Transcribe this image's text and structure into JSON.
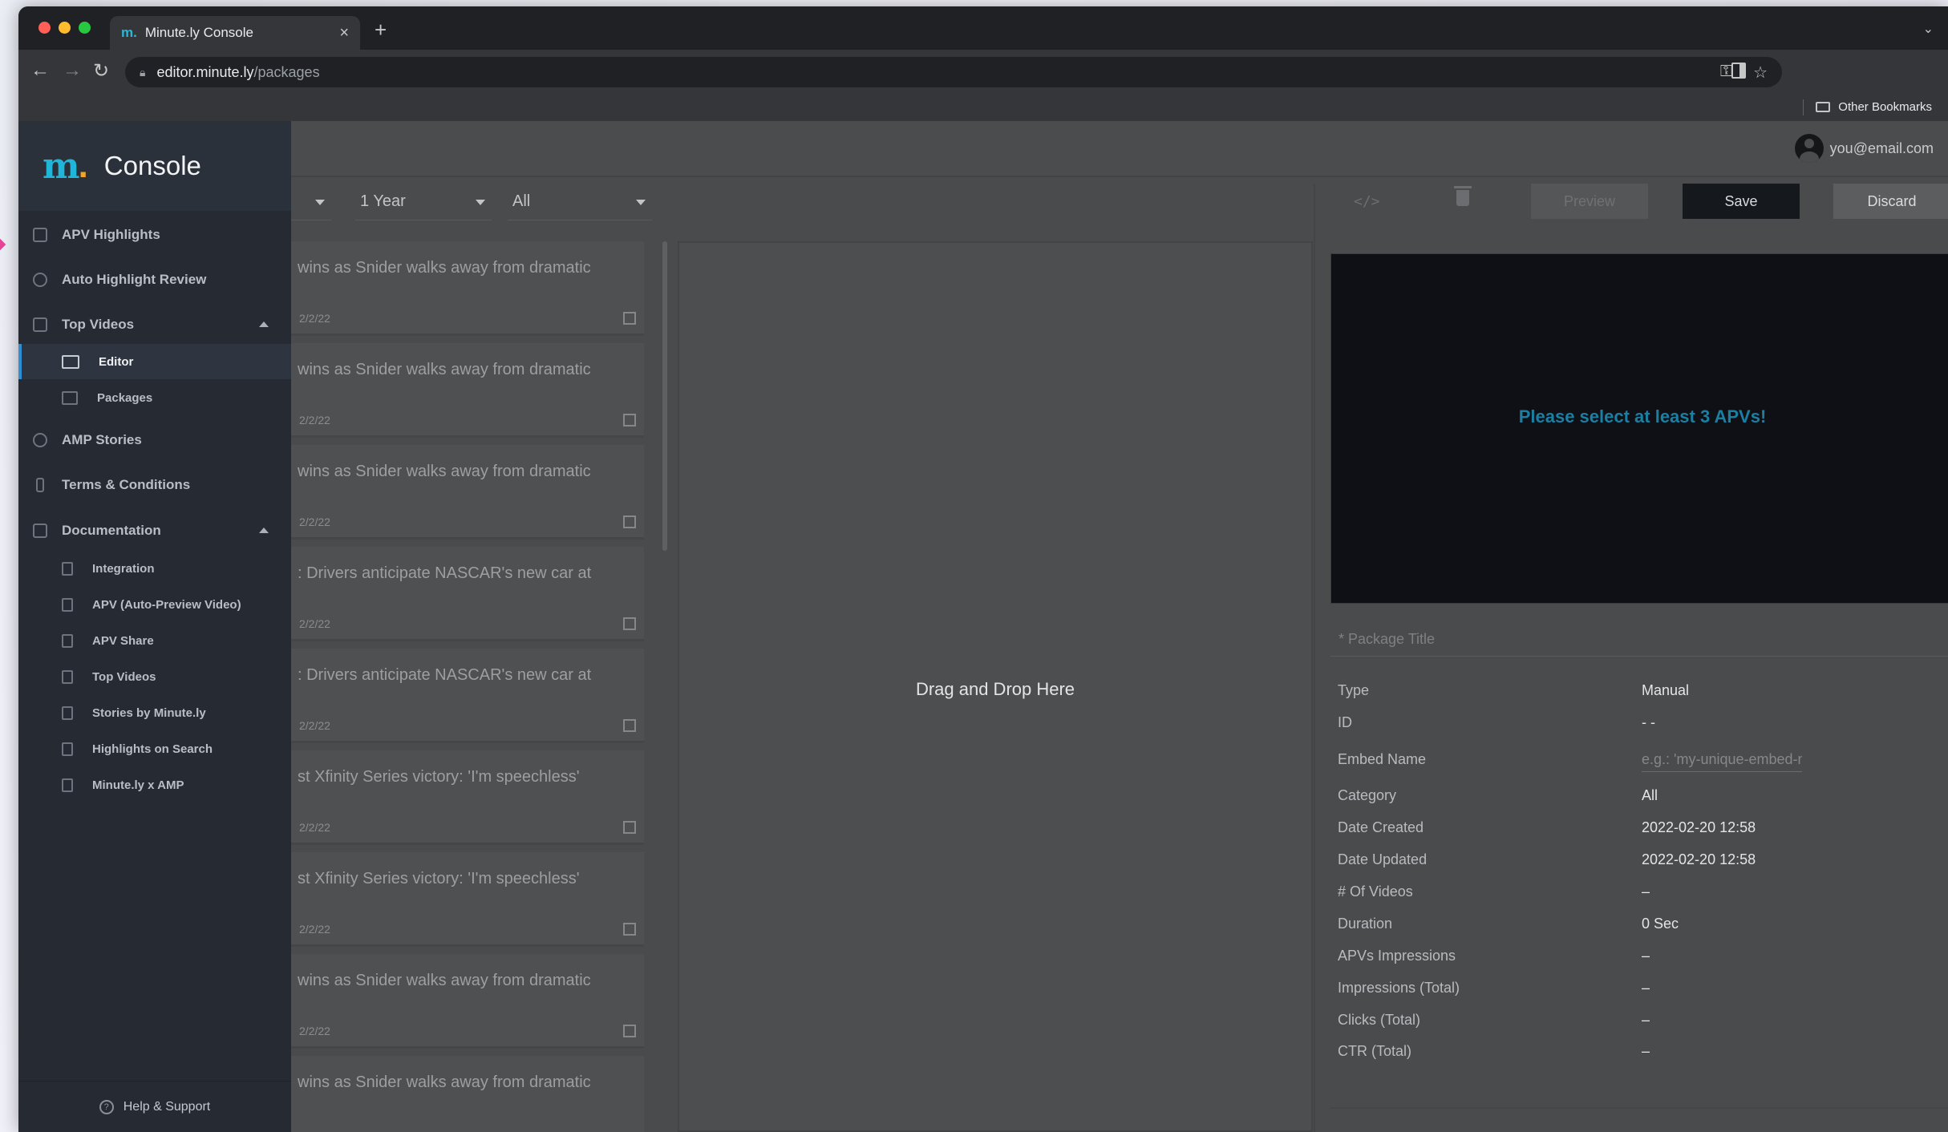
{
  "browser": {
    "tab_title": "Minute.ly Console",
    "tab_favicon": "m.",
    "url_host": "editor.minute.ly",
    "url_path": "/packages",
    "other_bookmarks": "Other Bookmarks"
  },
  "header": {
    "user_email": "you@email.com"
  },
  "brand": {
    "logo": "m",
    "logo_dot": ".",
    "title": "Console",
    "logo_color": "#1fb6d9",
    "dot_color": "#f2a623"
  },
  "sidebar": {
    "items": [
      {
        "label": "APV Highlights",
        "icon": "list-icon"
      },
      {
        "label": "Auto Highlight Review",
        "icon": "globe-icon"
      },
      {
        "label": "Top Videos",
        "icon": "film-icon",
        "expanded": true
      },
      {
        "label": "AMP Stories",
        "icon": "stories-icon"
      },
      {
        "label": "Terms & Conditions",
        "icon": "hand-icon"
      },
      {
        "label": "Documentation",
        "icon": "doc-icon",
        "expanded": true
      }
    ],
    "top_videos_sub": [
      {
        "label": "Editor",
        "active": true
      },
      {
        "label": "Packages"
      }
    ],
    "docs_sub": [
      {
        "label": "Integration"
      },
      {
        "label": "APV (Auto-Preview Video)"
      },
      {
        "label": "APV Share"
      },
      {
        "label": "Top Videos"
      },
      {
        "label": "Stories by Minute.ly"
      },
      {
        "label": "Highlights on Search"
      },
      {
        "label": "Minute.ly x AMP"
      }
    ],
    "help": "Help & Support"
  },
  "filters": {
    "period": "1 Year",
    "category": "All"
  },
  "videos": [
    {
      "title": "wins as Snider walks away from dramatic",
      "date": "2/2/22"
    },
    {
      "title": "wins as Snider walks away from dramatic",
      "date": "2/2/22"
    },
    {
      "title": "wins as Snider walks away from dramatic",
      "date": "2/2/22"
    },
    {
      "title": ": Drivers anticipate NASCAR's new car at",
      "date": "2/2/22"
    },
    {
      "title": ": Drivers anticipate NASCAR's new car at",
      "date": "2/2/22"
    },
    {
      "title": "st Xfinity Series victory: 'I'm speechless'",
      "date": "2/2/22"
    },
    {
      "title": "st Xfinity Series victory: 'I'm speechless'",
      "date": "2/2/22"
    },
    {
      "title": "wins as Snider walks away from dramatic",
      "date": "2/2/22"
    },
    {
      "title": "wins as Snider walks away from dramatic",
      "date": ""
    }
  ],
  "dropzone": {
    "text": "Drag and Drop Here"
  },
  "actions": {
    "preview": "Preview",
    "save": "Save",
    "discard": "Discard"
  },
  "player": {
    "message": "Please select at least 3 APVs!"
  },
  "package": {
    "title_placeholder": "* Package Title",
    "details": [
      {
        "key": "Type",
        "value": "Manual"
      },
      {
        "key": "ID",
        "value": "- -"
      },
      {
        "key": "Embed Name",
        "value": "e.g.: 'my-unique-embed-name'",
        "is_input": true
      },
      {
        "key": "Category",
        "value": "All"
      },
      {
        "key": "Date Created",
        "value": "2022-02-20 12:58"
      },
      {
        "key": "Date Updated",
        "value": "2022-02-20 12:58"
      },
      {
        "key": "# Of Videos",
        "value": "–"
      },
      {
        "key": "Duration",
        "value": "0 Sec"
      },
      {
        "key": "APVs Impressions",
        "value": "–"
      },
      {
        "key": "Impressions (Total)",
        "value": "–"
      },
      {
        "key": "Clicks (Total)",
        "value": "–"
      },
      {
        "key": "CTR (Total)",
        "value": "–"
      }
    ]
  }
}
